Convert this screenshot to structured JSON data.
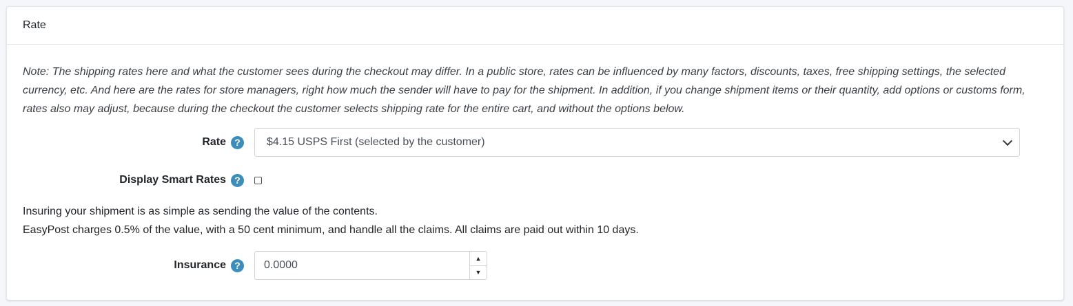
{
  "card": {
    "title": "Rate"
  },
  "note": "Note: The shipping rates here and what the customer sees during the checkout may differ. In a public store, rates can be influenced by many factors, discounts, taxes, free shipping settings, the selected currency, etc. And here are the rates for store managers, right how much the sender will have to pay for the shipment. In addition, if you change shipment items or their quantity, add options or customs form, rates also may adjust, because during the checkout the customer selects shipping rate for the entire cart, and without the options below.",
  "rate": {
    "label": "Rate",
    "help_glyph": "?",
    "selected": "$4.15 USPS First (selected by the customer)"
  },
  "smart_rates": {
    "label": "Display Smart Rates",
    "help_glyph": "?",
    "checked": false
  },
  "insurance_info": {
    "line1": "Insuring your shipment is as simple as sending the value of the contents.",
    "line2": "EasyPost charges 0.5% of the value, with a 50 cent minimum, and handle all the claims. All claims are paid out within 10 days."
  },
  "insurance": {
    "label": "Insurance",
    "help_glyph": "?",
    "value": "0.0000",
    "up_glyph": "▲",
    "down_glyph": "▼"
  },
  "colors": {
    "help_icon": "#3c8dbc",
    "border": "#ced4da",
    "background": "#f4f6f9"
  }
}
